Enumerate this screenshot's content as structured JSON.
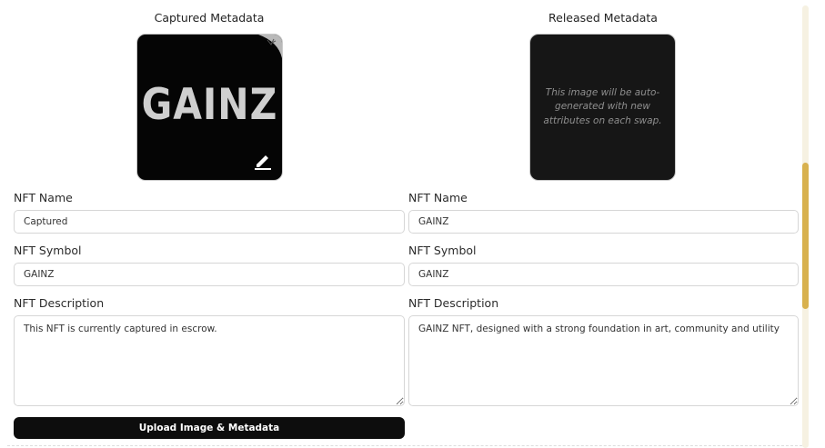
{
  "captured": {
    "heading": "Captured Metadata",
    "logo_text": "GAINZ",
    "name_label": "NFT Name",
    "name_value": "Captured",
    "symbol_label": "NFT Symbol",
    "symbol_value": "GAINZ",
    "description_label": "NFT Description",
    "description_value": "This NFT is currently captured in escrow."
  },
  "released": {
    "heading": "Released Metadata",
    "image_note": "This image will be auto-generated with new attributes on each swap.",
    "name_label": "NFT Name",
    "name_value": "GAINZ",
    "symbol_label": "NFT Symbol",
    "symbol_value": "GAINZ",
    "description_label": "NFT Description",
    "description_value": "GAINZ NFT, designed with a strong foundation in art, community and utility"
  },
  "actions": {
    "upload_label": "Upload Image & Metadata"
  },
  "icons": {
    "edit": "pencil-icon",
    "corner": "page-curl-icon"
  },
  "colors": {
    "accent_scrollbar": "#d8b14e",
    "button_bg": "#0d0d0d",
    "image_bg": "#050505"
  }
}
